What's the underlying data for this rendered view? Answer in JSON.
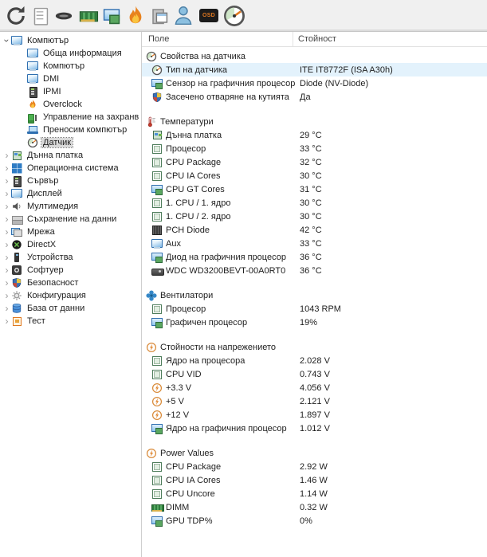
{
  "colors": {
    "toolbar_bg": "#f0f0f0",
    "row_highlight": "#e3f2fc",
    "tree_selection": "#d9d9d9",
    "osd_accent": "#e07820"
  },
  "toolbar": {
    "icons": [
      {
        "icon": "refresh"
      },
      {
        "icon": "report"
      },
      {
        "icon": "cpu"
      },
      {
        "icon": "ram"
      },
      {
        "icon": "video"
      },
      {
        "icon": "flame"
      },
      {
        "icon": "preferences"
      },
      {
        "icon": "user"
      },
      {
        "icon": "osd",
        "label": "OSD"
      },
      {
        "icon": "gauge"
      }
    ]
  },
  "sidebar": {
    "items": [
      {
        "label": "Компютър",
        "level": 0,
        "expanded": true,
        "icon": "monitor"
      },
      {
        "label": "Обща информация",
        "level": 1,
        "icon": "monitor"
      },
      {
        "label": "Компютър",
        "level": 1,
        "icon": "monitor"
      },
      {
        "label": "DMI",
        "level": 1,
        "icon": "monitor"
      },
      {
        "label": "IPMI",
        "level": 1,
        "icon": "server"
      },
      {
        "label": "Overclock",
        "level": 1,
        "icon": "flame"
      },
      {
        "label": "Управление на захранв",
        "level": 1,
        "icon": "battery"
      },
      {
        "label": "Преносим компютър",
        "level": 1,
        "icon": "laptop"
      },
      {
        "label": "Датчик",
        "level": 1,
        "icon": "gauge",
        "selected": true
      },
      {
        "label": "Дънна платка",
        "level": 0,
        "collapsed": true,
        "icon": "motherboard"
      },
      {
        "label": "Операционна система",
        "level": 0,
        "collapsed": true,
        "icon": "windows"
      },
      {
        "label": "Сървър",
        "level": 0,
        "collapsed": true,
        "icon": "server"
      },
      {
        "label": "Дисплей",
        "level": 0,
        "collapsed": true,
        "icon": "monitor"
      },
      {
        "label": "Мултимедия",
        "level": 0,
        "collapsed": true,
        "icon": "speaker"
      },
      {
        "label": "Съхранение на данни",
        "level": 0,
        "collapsed": true,
        "icon": "storage"
      },
      {
        "label": "Мрежа",
        "level": 0,
        "collapsed": true,
        "icon": "network"
      },
      {
        "label": "DirectX",
        "level": 0,
        "collapsed": true,
        "icon": "directx"
      },
      {
        "label": "Устройства",
        "level": 0,
        "collapsed": true,
        "icon": "device"
      },
      {
        "label": "Софтуер",
        "level": 0,
        "collapsed": true,
        "icon": "software"
      },
      {
        "label": "Безопасност",
        "level": 0,
        "collapsed": true,
        "icon": "shield"
      },
      {
        "label": "Конфигурация",
        "level": 0,
        "collapsed": true,
        "icon": "gear"
      },
      {
        "label": "База от данни",
        "level": 0,
        "collapsed": true,
        "icon": "database"
      },
      {
        "label": "Тест",
        "level": 0,
        "collapsed": true,
        "icon": "test"
      }
    ]
  },
  "panel": {
    "columns": [
      "Поле",
      "Стойност"
    ],
    "sections": [
      {
        "title": "Свойства на датчика",
        "icon": "gauge",
        "rows": [
          {
            "label": "Тип на датчика",
            "icon": "gauge",
            "value": "ITE IT8772F  (ISA A30h)",
            "highlighted": true
          },
          {
            "label": "Сензор на графичния процесор",
            "icon": "video",
            "value": "Diode  (NV-Diode)"
          },
          {
            "label": "Засечено отваряне на кутията",
            "icon": "shield",
            "value": "Да"
          }
        ]
      },
      {
        "title": "Температури",
        "icon": "thermometer",
        "rows": [
          {
            "label": "Дънна платка",
            "icon": "motherboard",
            "value": "29 °C"
          },
          {
            "label": "Процесор",
            "icon": "chip",
            "value": "33 °C"
          },
          {
            "label": "CPU Package",
            "icon": "chip",
            "value": "32 °C"
          },
          {
            "label": "CPU IA Cores",
            "icon": "chip",
            "value": "30 °C"
          },
          {
            "label": "CPU GT Cores",
            "icon": "video",
            "value": "31 °C"
          },
          {
            "label": "1. CPU / 1. ядро",
            "icon": "chip",
            "value": "30 °C"
          },
          {
            "label": "1. CPU / 2. ядро",
            "icon": "chip",
            "value": "30 °C"
          },
          {
            "label": "PCH Diode",
            "icon": "chip-dark",
            "value": "42 °C"
          },
          {
            "label": "Aux",
            "icon": "monitor",
            "value": "33 °C"
          },
          {
            "label": "Диод на графичния процесор",
            "icon": "video",
            "value": "36 °C"
          },
          {
            "label": "WDC WD3200BEVT-00A0RT0",
            "icon": "hdd",
            "value": "36 °C"
          }
        ]
      },
      {
        "title": "Вентилатори",
        "icon": "fan",
        "rows": [
          {
            "label": "Процесор",
            "icon": "chip",
            "value": "1043 RPM"
          },
          {
            "label": "Графичен процесор",
            "icon": "video",
            "value": "19%"
          }
        ]
      },
      {
        "title": "Стойности на напрежението",
        "icon": "voltage",
        "rows": [
          {
            "label": "Ядро на процесора",
            "icon": "chip",
            "value": "2.028 V"
          },
          {
            "label": "CPU VID",
            "icon": "chip",
            "value": "0.743 V"
          },
          {
            "label": "+3.3 V",
            "icon": "voltage",
            "value": "4.056 V"
          },
          {
            "label": "+5 V",
            "icon": "voltage",
            "value": "2.121 V"
          },
          {
            "label": "+12 V",
            "icon": "voltage",
            "value": "1.897 V"
          },
          {
            "label": "Ядро на графичния процесор",
            "icon": "video",
            "value": "1.012 V"
          }
        ]
      },
      {
        "title": "Power Values",
        "icon": "voltage",
        "rows": [
          {
            "label": "CPU Package",
            "icon": "chip",
            "value": "2.92 W"
          },
          {
            "label": "CPU IA Cores",
            "icon": "chip",
            "value": "1.46 W"
          },
          {
            "label": "CPU Uncore",
            "icon": "chip",
            "value": "1.14 W"
          },
          {
            "label": "DIMM",
            "icon": "ram",
            "value": "0.32 W"
          },
          {
            "label": "GPU TDP%",
            "icon": "video",
            "value": "0%"
          }
        ]
      }
    ]
  }
}
